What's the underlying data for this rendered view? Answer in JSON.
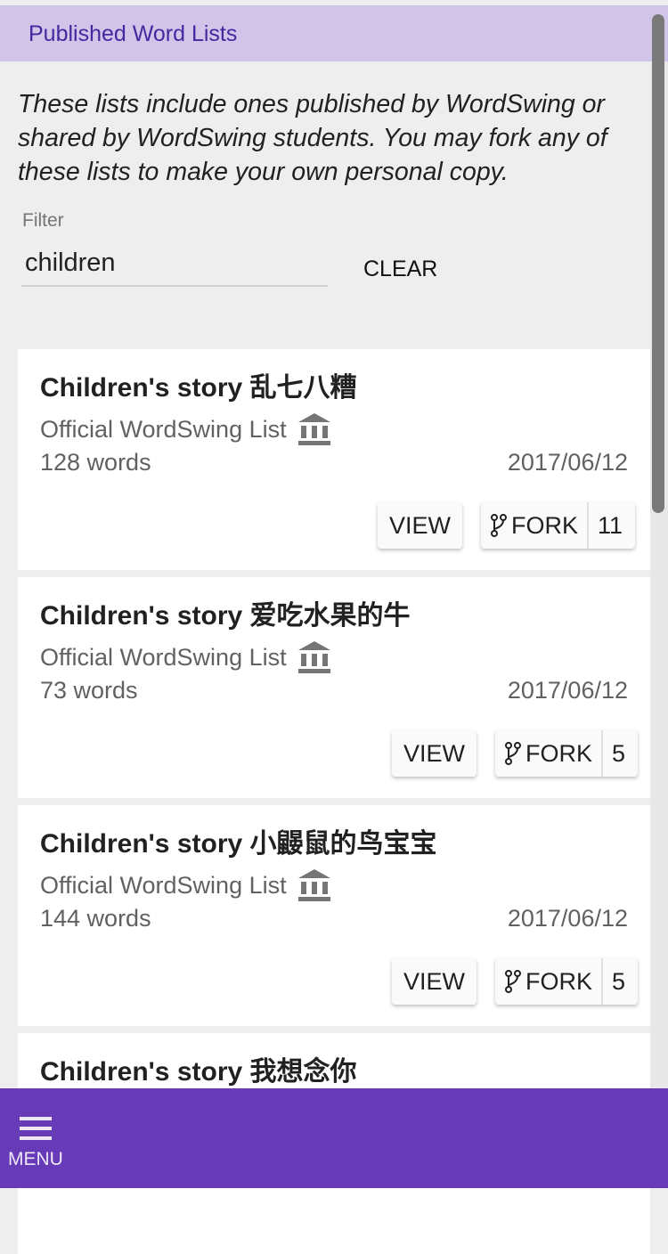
{
  "header": {
    "title": "Published Word Lists"
  },
  "intro": "These lists include ones published by WordSwing or shared by WordSwing students. You may fork any of these lists to make your own personal copy.",
  "filter": {
    "label": "Filter",
    "value": "children",
    "clear_label": "CLEAR"
  },
  "lists": [
    {
      "title": "Children's story 乱七八糟",
      "source": "Official WordSwing List",
      "source_icon": "bank-icon",
      "words": "128 words",
      "date": "2017/06/12",
      "view_label": "VIEW",
      "fork_label": "FORK",
      "fork_count": "11"
    },
    {
      "title": "Children's story 爱吃水果的牛",
      "source": "Official WordSwing List",
      "source_icon": "bank-icon",
      "words": "73 words",
      "date": "2017/06/12",
      "view_label": "VIEW",
      "fork_label": "FORK",
      "fork_count": "5"
    },
    {
      "title": "Children's story 小鼹鼠的鸟宝宝",
      "source": "Official WordSwing List",
      "source_icon": "bank-icon",
      "words": "144 words",
      "date": "2017/06/12",
      "view_label": "VIEW",
      "fork_label": "FORK",
      "fork_count": "5"
    },
    {
      "title": "Children's story 我想念你"
    }
  ],
  "bottom_bar": {
    "menu_label": "MENU",
    "menu_icon": "hamburger-icon"
  },
  "colors": {
    "header_bg": "#d1c4e9",
    "header_text": "#4527a0",
    "bottom_bar": "#673ab7"
  }
}
